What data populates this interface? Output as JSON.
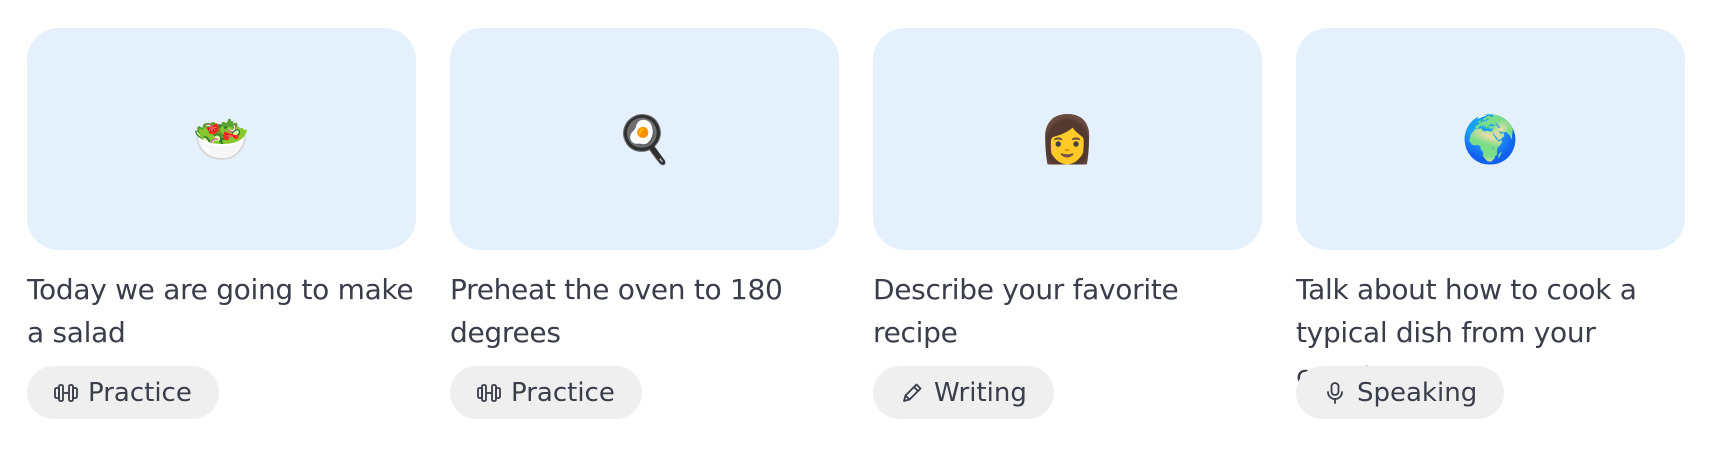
{
  "cards": [
    {
      "emoji": "🥗",
      "icon": "salad-icon",
      "title": "Today we are going to make a salad",
      "tag": {
        "label": "Practice",
        "icon": "dumbbell-icon"
      }
    },
    {
      "emoji": "🍳",
      "icon": "frying-pan-egg-icon",
      "title": "Preheat the oven to 180 degrees",
      "tag": {
        "label": "Practice",
        "icon": "dumbbell-icon"
      }
    },
    {
      "emoji": "👩",
      "icon": "woman-icon",
      "title": "Describe your favorite recipe",
      "tag": {
        "label": "Writing",
        "icon": "pencil-icon"
      }
    },
    {
      "emoji": "🌍",
      "icon": "globe-icon",
      "title": "Talk about how to cook a typical dish from your country",
      "tag": {
        "label": "Speaking",
        "icon": "microphone-icon"
      }
    }
  ],
  "colors": {
    "thumb_bg": "#e4f1fd",
    "tag_bg": "#efefef",
    "text": "#3a3d4a"
  }
}
